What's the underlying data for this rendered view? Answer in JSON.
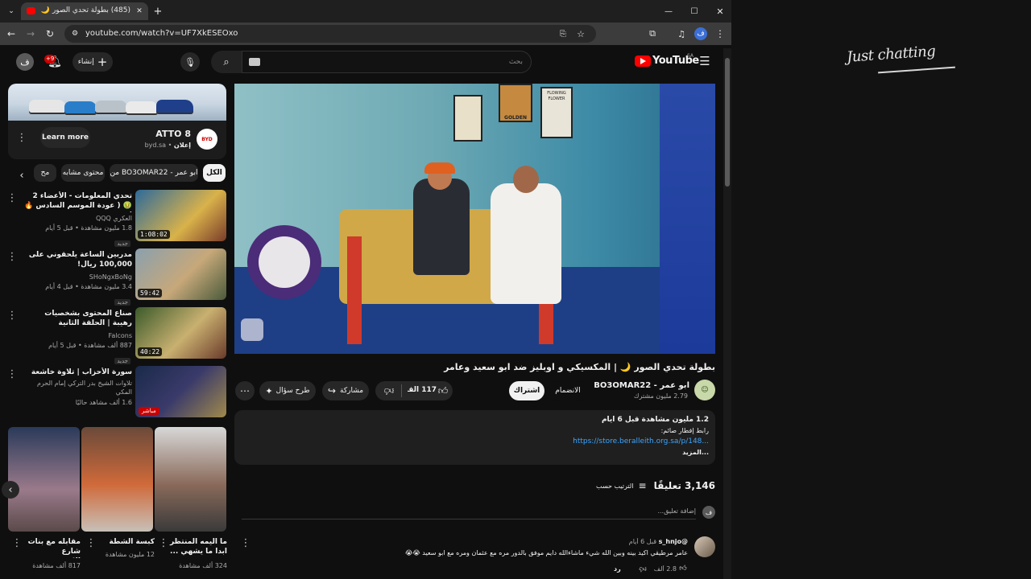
{
  "browser": {
    "tab_title": "(485) بطولة تحدي الصور 🌙",
    "new_tab_icon": "plus-icon",
    "url": "youtube.com/watch?v=UF7XkESEOxo",
    "window_controls": [
      "minimize-icon",
      "maximize-icon",
      "close-icon"
    ]
  },
  "header": {
    "logo_text": "YouTube",
    "region": "SA",
    "search_placeholder": "بحث",
    "create_label": "إنشاء",
    "notification_count": "+9",
    "avatar_letter": "ف"
  },
  "ad": {
    "title": "ATTO 8",
    "domain": "byd.sa",
    "sponsored": "إعلان",
    "learn_more": "Learn more",
    "brand": "BYD"
  },
  "chips": [
    "الكل",
    "من BO3OMAR22 - ابو عمر",
    "محتوى مشابه",
    "مح"
  ],
  "recommendations": [
    {
      "title": "تحدي المعلومات - الأعضاء 2 🤢 ( عودة الموسم السادس 🔥 )",
      "channel": "العكري QQQ",
      "meta": "1.8 مليون مشاهدة • قبل 5 أيام",
      "badge": "جديد",
      "duration": "1:08:02"
    },
    {
      "title": "مدربين الساعة يلحقوني على 100,000 ريال!",
      "channel": "SHoNgxBoNg",
      "meta": "3.4 مليون مشاهدة • قبل 4 أيام",
      "badge": "جديد",
      "duration": "59:42"
    },
    {
      "title": "صناع المحتوى بشخصيات رهيبة | الحلقة الثانية",
      "channel": "Falcons",
      "meta": "887 ألف مشاهدة • قبل 5 أيام",
      "badge": "جديد",
      "duration": "40:22"
    },
    {
      "title": "سورة الأحزاب | تلاوة خاشعة بدر التركي",
      "channel": "تلاوات الشيخ بدر التركي إمام الحرم المكي",
      "meta": "1.6 ألف مشاهد حاليًا",
      "badge": "مباشر",
      "duration": ""
    }
  ],
  "shorts": [
    {
      "title": "ما اليمه المنتظر ابدا ما يشهي ...",
      "views": "324 ألف مشاهدة"
    },
    {
      "title": "كبسة الشطة",
      "views": "12 مليون مشاهدة"
    },
    {
      "title": "مقابله مع بنات شارع الاعتبي...",
      "views": "817 ألف مشاهدة"
    }
  ],
  "video": {
    "title": "بطولة تحدي الصور 🌙 | المكسيكي و اوبليز ضد ابو سعيد وعامر",
    "channel": "ابو عمر - BO3OMAR22",
    "subscribers": "2.79 مليون مشترك",
    "join_label": "الانضمام",
    "subscribed_label": "اشتراك",
    "likes": "117 ألف",
    "share_label": "مشاركة",
    "ask_label": "طرح سؤال",
    "room_sign": "GOLDEN",
    "flowing_sign": "FLOWING FLOWER"
  },
  "description": {
    "views_date": "1.2 مليون مشاهدة  قبل 6 أيام",
    "line1": "رابط إفطار صائم:",
    "link": "https://store.beralleith.org.sa/p/148...",
    "more": "...المزيد"
  },
  "comments": {
    "count": "3,146 تعليقًا",
    "sort_label": "الترتيب حسب",
    "add_placeholder": "إضافة تعليق...",
    "items": [
      {
        "author": "@s_hnjo",
        "time": "قبل 6 أيام",
        "text": "عامر مرطيقي اكيد بينه وبين الله شيء ماشاءالله دايم موفق بالدور مره مع عثمان ومره مع ابو سعيد 😭😭",
        "likes": "2.8 ألف",
        "reply": "رد"
      }
    ]
  },
  "overlay": {
    "caption": "Just chatting"
  },
  "colors": {
    "bg": "#0f0f0f",
    "accent_red": "#ff0000",
    "link": "#3ea6ff"
  }
}
